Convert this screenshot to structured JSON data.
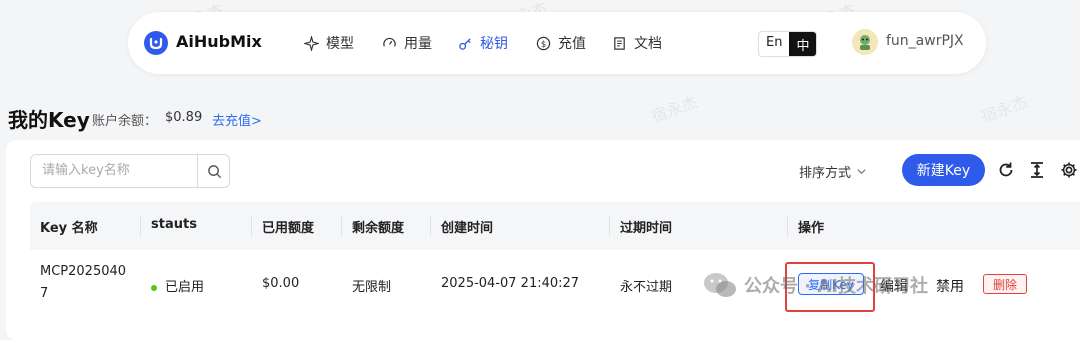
{
  "nav": {
    "brand": "AiHubMix",
    "items": [
      {
        "label": "模型",
        "icon": "sparkle-icon"
      },
      {
        "label": "用量",
        "icon": "gauge-icon"
      },
      {
        "label": "秘钥",
        "icon": "key-icon",
        "active": true
      },
      {
        "label": "充值",
        "icon": "dollar-icon"
      },
      {
        "label": "文档",
        "icon": "document-icon"
      }
    ],
    "lang_en": "En",
    "lang_zh": "中",
    "username": "fun_awrPJX"
  },
  "page": {
    "title": "我的Key",
    "balance_label": "账户余额：",
    "balance_value": "$0.89",
    "recharge_link": "去充值>"
  },
  "toolbar": {
    "search_placeholder": "请输入key名称",
    "sort_label": "排序方式",
    "new_key_label": "新建Key"
  },
  "table": {
    "headers": [
      "Key 名称",
      "stauts",
      "已用额度",
      "剩余额度",
      "创建时间",
      "过期时间",
      "操作"
    ],
    "rows": [
      {
        "name_line1": "MCP2025040",
        "name_line2": "7",
        "status": "已启用",
        "used": "$0.00",
        "remaining": "无限制",
        "created": "2025-04-07 21:40:27",
        "expires": "永不过期",
        "actions": {
          "copy": "复制Key",
          "edit": "编辑",
          "disable": "禁用",
          "delete": "删除"
        }
      }
    ]
  },
  "watermark": {
    "channel": "公众号 · AI技术研习社",
    "faint": "宿永杰"
  },
  "colors": {
    "accent": "#2f5bea",
    "link": "#2f6cf6",
    "status_active": "#52c41a",
    "danger": "#e0433b"
  }
}
